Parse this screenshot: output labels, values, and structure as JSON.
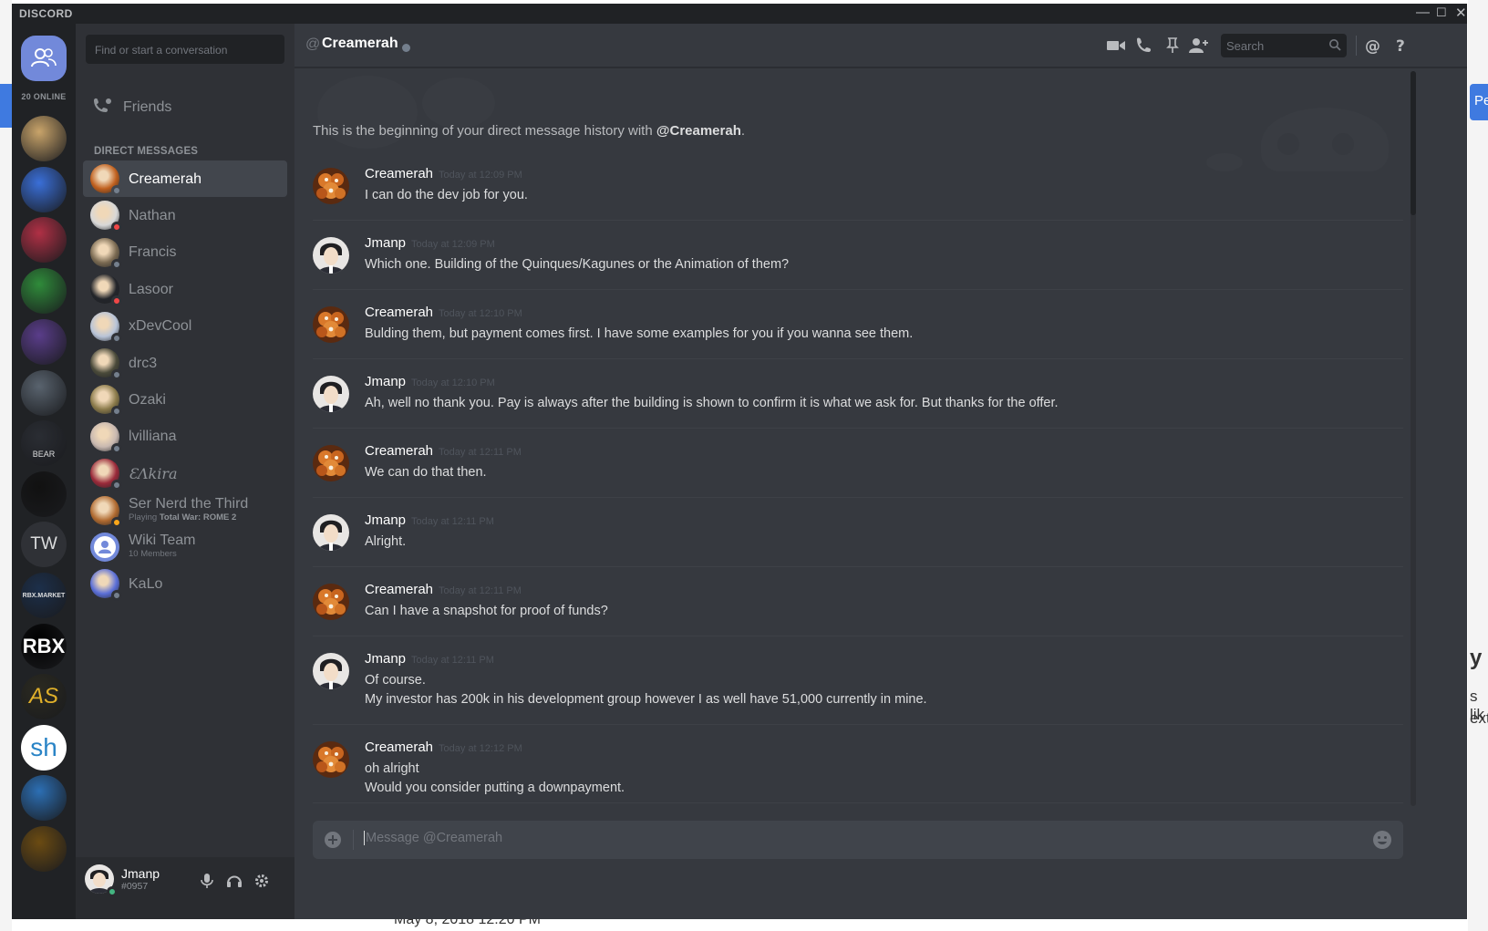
{
  "app": {
    "brand": "DISCORD",
    "window_controls": {
      "minimize": "—",
      "maximize": "☐",
      "close": "✕"
    }
  },
  "background": {
    "right_tab_text": "Pe",
    "right_text_1": "y",
    "right_text_2": "s lik",
    "right_text_3": "ext.",
    "date_text": "May 8, 2018 12:20 PM"
  },
  "guilds": {
    "online_count": "20 ONLINE",
    "items": [
      {
        "name": "anime-face",
        "color": "#c9a46a"
      },
      {
        "name": "blue-globe",
        "color": "#3a6fd8"
      },
      {
        "name": "red-character",
        "color": "#b03045"
      },
      {
        "name": "hero-academia",
        "color": "#2f8b3a"
      },
      {
        "name": "purple-hero",
        "color": "#5a3d8a"
      },
      {
        "name": "grey-figure",
        "color": "#59636e"
      },
      {
        "name": "bear-studio",
        "text": "BEAR",
        "color": "#2a2d33"
      },
      {
        "name": "wolf",
        "color": "#111111"
      },
      {
        "name": "tw",
        "text": "TW",
        "color": "#2f3136"
      },
      {
        "name": "rbx-market",
        "text": "RBX.MARKET",
        "color": "#1c2f4a"
      },
      {
        "name": "rbx-place",
        "text": "RBX",
        "color": "#000000"
      },
      {
        "name": "as",
        "text": "AS",
        "color": "#2b2a20"
      },
      {
        "name": "sh",
        "text": "sh",
        "color": "#ffffff"
      },
      {
        "name": "ice",
        "color": "#2c6fb4"
      },
      {
        "name": "gold-crest",
        "color": "#6b4b12"
      }
    ]
  },
  "sidebar": {
    "search_placeholder": "Find or start a conversation",
    "friends_label": "Friends",
    "dm_header": "DIRECT MESSAGES",
    "dms": [
      {
        "name": "Creamerah",
        "status": "offline",
        "active": true,
        "color": "#c0601e"
      },
      {
        "name": "Nathan",
        "status": "dnd",
        "color": "#d8d8d8"
      },
      {
        "name": "Francis",
        "status": "offline",
        "color": "#7a6a52"
      },
      {
        "name": "Lasoor",
        "status": "dnd",
        "color": "#23252a"
      },
      {
        "name": "xDevCool",
        "status": "offline",
        "color": "#b8c4d8"
      },
      {
        "name": "drc3",
        "status": "offline",
        "color": "#4a4a3a"
      },
      {
        "name": "Ozaki",
        "status": "offline",
        "color": "#8a7a4a"
      },
      {
        "name": "lvilliana",
        "status": "offline",
        "color": "#c8b8b0"
      },
      {
        "name": "ƐɅkira",
        "status": "offline",
        "color": "#9a2a3a"
      },
      {
        "name": "Ser Nerd the Third",
        "status": "idle",
        "sub_prefix": "Playing ",
        "sub_bold": "Total War: ROME 2",
        "color": "#b06a30"
      },
      {
        "name": "Wiki Team",
        "group": true,
        "sub": "10 Members",
        "color": "#7289da"
      },
      {
        "name": "KaLo",
        "status": "offline",
        "color": "#5b6fd8"
      }
    ]
  },
  "user": {
    "name": "Jmanp",
    "tag": "#0957",
    "status": "online"
  },
  "chat": {
    "at": "@",
    "title": "Creamerah",
    "search_placeholder": "Search",
    "begin_prefix": "This is the beginning of your direct message history with ",
    "begin_user": "@Creamerah",
    "begin_suffix": ".",
    "composer_placeholder": "Message @Creamerah",
    "messages": [
      {
        "author": "Creamerah",
        "time": "Today at 12:09 PM",
        "lines": [
          "I can do the dev job for you."
        ]
      },
      {
        "author": "Jmanp",
        "time": "Today at 12:09 PM",
        "lines": [
          "Which one. Building of the Quinques/Kagunes or the Animation of them?"
        ]
      },
      {
        "author": "Creamerah",
        "time": "Today at 12:10 PM",
        "lines": [
          "Bulding them, but payment comes first. I have some examples for you if you wanna see them."
        ]
      },
      {
        "author": "Jmanp",
        "time": "Today at 12:10 PM",
        "lines": [
          "Ah, well no thank you. Pay is always after the building is shown to confirm it is what we ask for. But thanks for the offer."
        ]
      },
      {
        "author": "Creamerah",
        "time": "Today at 12:11 PM",
        "lines": [
          "We can do that then."
        ]
      },
      {
        "author": "Jmanp",
        "time": "Today at 12:11 PM",
        "lines": [
          "Alright."
        ]
      },
      {
        "author": "Creamerah",
        "time": "Today at 12:11 PM",
        "lines": [
          "Can I have a snapshot for proof of funds?"
        ]
      },
      {
        "author": "Jmanp",
        "time": "Today at 12:11 PM",
        "lines": [
          "Of course.",
          "My investor has 200k in his development group however I as well have 51,000 currently in mine."
        ]
      },
      {
        "author": "Creamerah",
        "time": "Today at 12:12 PM",
        "lines": [
          "oh alright",
          "Would you consider putting a downpayment."
        ]
      }
    ]
  }
}
